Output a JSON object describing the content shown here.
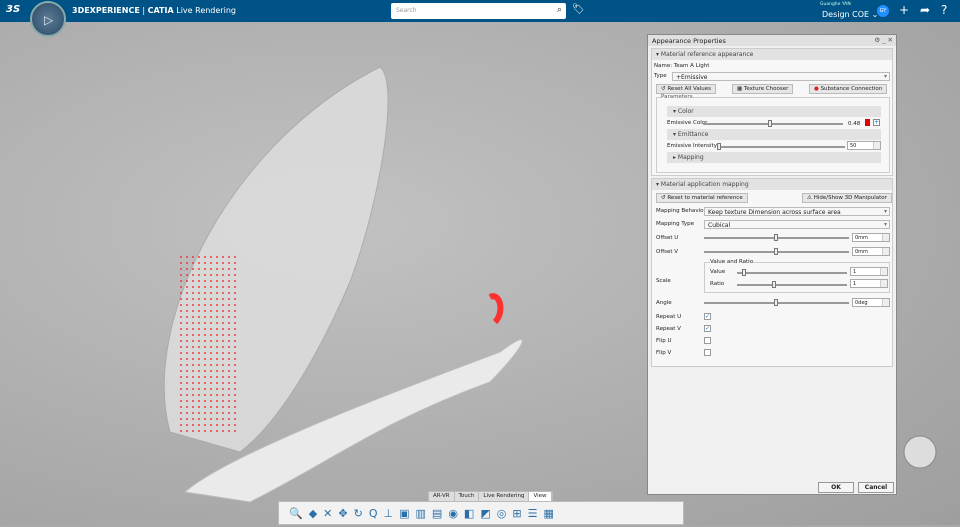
{
  "header": {
    "brand": "3DEXPERIENCE",
    "separator": "|",
    "product": "CATIA",
    "app": "Live Rendering",
    "search_placeholder": "Search",
    "user_name": "Guanghe YAN",
    "collab_space": "Design COE",
    "avatar_initials": "GY",
    "compass_label": "▷"
  },
  "dialog": {
    "title": "Appearance Properties",
    "material_section": "Material reference appearance",
    "name_label": "Name:",
    "name_value": "Team A Light",
    "type_label": "Type",
    "type_value": "+Emissive",
    "reset_all": "Reset All Values",
    "texture_chooser": "Texture Chooser",
    "substance": "Substance Connection",
    "parameters": "Parameters",
    "color_group": "Color",
    "emissive_color_label": "Emissive Color",
    "emissive_color_value": "0.48",
    "emissive_color_swatch": "#e00000",
    "emissive_color_slider": 0.48,
    "emittance_group": "Emittance",
    "emissive_intensity_label": "Emissive Intensity",
    "emissive_intensity_value": "50",
    "mapping_group": "Mapping",
    "mapping_section": "Material application mapping",
    "reset_material": "Reset to material reference",
    "hide_show": "Hide/Show 3D Manipulator",
    "mapping_behavior_label": "Mapping Behavio",
    "mapping_behavior_value": "Keep texture Dimension across surface area",
    "mapping_type_label": "Mapping Type",
    "mapping_type_value": "Cubical",
    "offset_u_label": "Offset U",
    "offset_u_value": "0mm",
    "offset_v_label": "Offset V",
    "offset_v_value": "0mm",
    "scale_label": "Scale",
    "value_ratio_group": "Value and Ratio",
    "value_label": "Value",
    "value_value": "1",
    "ratio_label": "Ratio",
    "ratio_value": "1",
    "angle_label": "Angle",
    "angle_value": "0deg",
    "repeat_u_label": "Repeat U",
    "repeat_u": true,
    "repeat_v_label": "Repeat V",
    "repeat_v": true,
    "flip_u_label": "Flip U",
    "flip_u": false,
    "flip_v_label": "Flip V",
    "flip_v": false,
    "ok": "OK",
    "cancel": "Cancel"
  },
  "tabs": [
    "AR-VR",
    "Touch",
    "Live Rendering",
    "View"
  ],
  "toolbar_icons": [
    "fly-mode-icon",
    "view-cube-icon",
    "fit-all-icon",
    "pan-icon",
    "rotate-icon",
    "zoom-icon",
    "normal-view-icon",
    "projection-icon",
    "render-style-icon",
    "lighting-icon",
    "hide-show-icon",
    "selection-icon",
    "view-mode-icon",
    "environment-icon",
    "multi-view-icon",
    "tree-icon",
    "ghost-icon"
  ],
  "toolbar_glyphs": [
    "🔍",
    "◆",
    "✕",
    "✥",
    "↻",
    "Q",
    "⊥",
    "▣",
    "▥",
    "▤",
    "◉",
    "◧",
    "◩",
    "◎",
    "⊞",
    "☰",
    "▦"
  ]
}
